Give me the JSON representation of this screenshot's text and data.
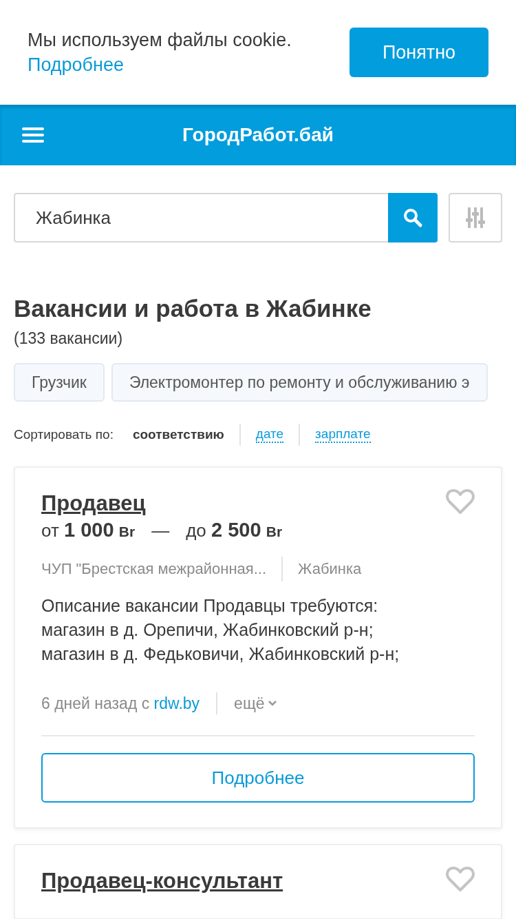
{
  "cookie_banner": {
    "text": "Мы используем файлы cookie.",
    "link": "Подробнее",
    "button": "Понятно"
  },
  "header": {
    "logo": "ГородРабот.бай"
  },
  "search": {
    "value": "Жабинка"
  },
  "heading": "Вакансии и работа в Жабинке",
  "count": "(133 вакансии)",
  "tags": [
    "Грузчик",
    "Электромонтер по ремонту и обслуживанию э"
  ],
  "sort": {
    "label": "Сортировать по:",
    "options": [
      {
        "label": "соответствию",
        "selected": true
      },
      {
        "label": "дате",
        "selected": false
      },
      {
        "label": "зарплате",
        "selected": false
      }
    ]
  },
  "vacancies": [
    {
      "title": "Продавец",
      "favorite": false,
      "salary": {
        "from_prefix": "от",
        "from_amount": "1 000",
        "to_prefix": "до",
        "from_currency": "Br",
        "to_amount": "2 500",
        "to_currency": "Br",
        "separator": "—"
      },
      "company": "ЧУП \"Брестская межрайонная...",
      "city": "Жабинка",
      "description": "Описание вакансии Продавцы требуются: магазин в д. Орепичи, Жабинковский р-н; магазин в д. Федьковичи, Жабинковский р-н;",
      "posted": "6 дней назад с",
      "source": "rdw.by",
      "more": "ещё",
      "button": "Подробнее"
    },
    {
      "title": "Продавец-консультант",
      "favorite": false
    }
  ]
}
